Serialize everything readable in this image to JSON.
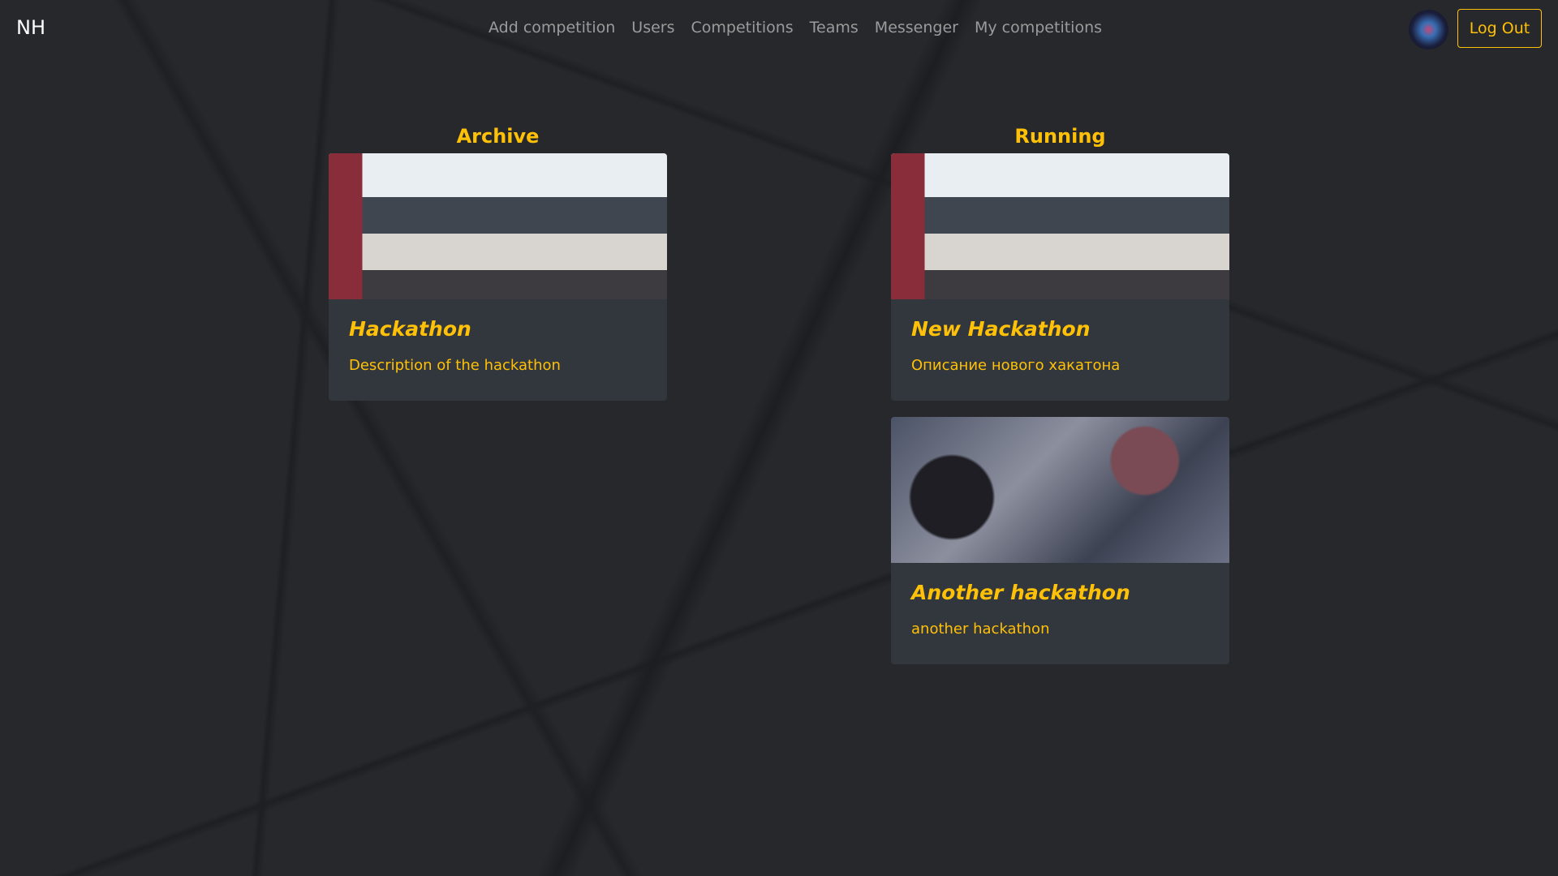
{
  "nav": {
    "brand": "NH",
    "links": [
      "Add competition",
      "Users",
      "Competitions",
      "Teams",
      "Messenger",
      "My competitions"
    ],
    "logout": "Log Out"
  },
  "archive": {
    "heading": "Archive",
    "cards": [
      {
        "title": "Hackathon",
        "description": "Description of the hackathon"
      }
    ]
  },
  "running": {
    "heading": "Running",
    "cards": [
      {
        "title": "New Hackathon",
        "description": "Описание нового хакатона"
      },
      {
        "title": "Another hackathon",
        "description": "another hackathon"
      }
    ]
  },
  "colors": {
    "accent": "#ffc107",
    "card": "#32363d",
    "background": "#27282c"
  }
}
